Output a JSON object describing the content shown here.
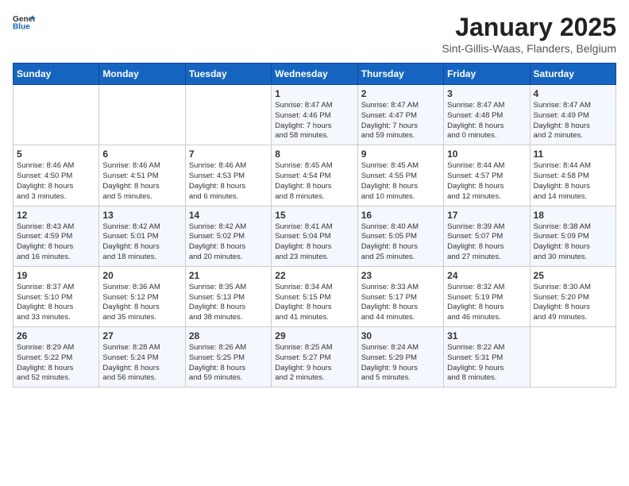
{
  "header": {
    "logo_general": "General",
    "logo_blue": "Blue",
    "month_title": "January 2025",
    "location": "Sint-Gillis-Waas, Flanders, Belgium"
  },
  "weekdays": [
    "Sunday",
    "Monday",
    "Tuesday",
    "Wednesday",
    "Thursday",
    "Friday",
    "Saturday"
  ],
  "weeks": [
    [
      {
        "day": "",
        "text": ""
      },
      {
        "day": "",
        "text": ""
      },
      {
        "day": "",
        "text": ""
      },
      {
        "day": "1",
        "text": "Sunrise: 8:47 AM\nSunset: 4:46 PM\nDaylight: 7 hours\nand 58 minutes."
      },
      {
        "day": "2",
        "text": "Sunrise: 8:47 AM\nSunset: 4:47 PM\nDaylight: 7 hours\nand 59 minutes."
      },
      {
        "day": "3",
        "text": "Sunrise: 8:47 AM\nSunset: 4:48 PM\nDaylight: 8 hours\nand 0 minutes."
      },
      {
        "day": "4",
        "text": "Sunrise: 8:47 AM\nSunset: 4:49 PM\nDaylight: 8 hours\nand 2 minutes."
      }
    ],
    [
      {
        "day": "5",
        "text": "Sunrise: 8:46 AM\nSunset: 4:50 PM\nDaylight: 8 hours\nand 3 minutes."
      },
      {
        "day": "6",
        "text": "Sunrise: 8:46 AM\nSunset: 4:51 PM\nDaylight: 8 hours\nand 5 minutes."
      },
      {
        "day": "7",
        "text": "Sunrise: 8:46 AM\nSunset: 4:53 PM\nDaylight: 8 hours\nand 6 minutes."
      },
      {
        "day": "8",
        "text": "Sunrise: 8:45 AM\nSunset: 4:54 PM\nDaylight: 8 hours\nand 8 minutes."
      },
      {
        "day": "9",
        "text": "Sunrise: 8:45 AM\nSunset: 4:55 PM\nDaylight: 8 hours\nand 10 minutes."
      },
      {
        "day": "10",
        "text": "Sunrise: 8:44 AM\nSunset: 4:57 PM\nDaylight: 8 hours\nand 12 minutes."
      },
      {
        "day": "11",
        "text": "Sunrise: 8:44 AM\nSunset: 4:58 PM\nDaylight: 8 hours\nand 14 minutes."
      }
    ],
    [
      {
        "day": "12",
        "text": "Sunrise: 8:43 AM\nSunset: 4:59 PM\nDaylight: 8 hours\nand 16 minutes."
      },
      {
        "day": "13",
        "text": "Sunrise: 8:42 AM\nSunset: 5:01 PM\nDaylight: 8 hours\nand 18 minutes."
      },
      {
        "day": "14",
        "text": "Sunrise: 8:42 AM\nSunset: 5:02 PM\nDaylight: 8 hours\nand 20 minutes."
      },
      {
        "day": "15",
        "text": "Sunrise: 8:41 AM\nSunset: 5:04 PM\nDaylight: 8 hours\nand 23 minutes."
      },
      {
        "day": "16",
        "text": "Sunrise: 8:40 AM\nSunset: 5:05 PM\nDaylight: 8 hours\nand 25 minutes."
      },
      {
        "day": "17",
        "text": "Sunrise: 8:39 AM\nSunset: 5:07 PM\nDaylight: 8 hours\nand 27 minutes."
      },
      {
        "day": "18",
        "text": "Sunrise: 8:38 AM\nSunset: 5:09 PM\nDaylight: 8 hours\nand 30 minutes."
      }
    ],
    [
      {
        "day": "19",
        "text": "Sunrise: 8:37 AM\nSunset: 5:10 PM\nDaylight: 8 hours\nand 33 minutes."
      },
      {
        "day": "20",
        "text": "Sunrise: 8:36 AM\nSunset: 5:12 PM\nDaylight: 8 hours\nand 35 minutes."
      },
      {
        "day": "21",
        "text": "Sunrise: 8:35 AM\nSunset: 5:13 PM\nDaylight: 8 hours\nand 38 minutes."
      },
      {
        "day": "22",
        "text": "Sunrise: 8:34 AM\nSunset: 5:15 PM\nDaylight: 8 hours\nand 41 minutes."
      },
      {
        "day": "23",
        "text": "Sunrise: 8:33 AM\nSunset: 5:17 PM\nDaylight: 8 hours\nand 44 minutes."
      },
      {
        "day": "24",
        "text": "Sunrise: 8:32 AM\nSunset: 5:19 PM\nDaylight: 8 hours\nand 46 minutes."
      },
      {
        "day": "25",
        "text": "Sunrise: 8:30 AM\nSunset: 5:20 PM\nDaylight: 8 hours\nand 49 minutes."
      }
    ],
    [
      {
        "day": "26",
        "text": "Sunrise: 8:29 AM\nSunset: 5:22 PM\nDaylight: 8 hours\nand 52 minutes."
      },
      {
        "day": "27",
        "text": "Sunrise: 8:28 AM\nSunset: 5:24 PM\nDaylight: 8 hours\nand 56 minutes."
      },
      {
        "day": "28",
        "text": "Sunrise: 8:26 AM\nSunset: 5:25 PM\nDaylight: 8 hours\nand 59 minutes."
      },
      {
        "day": "29",
        "text": "Sunrise: 8:25 AM\nSunset: 5:27 PM\nDaylight: 9 hours\nand 2 minutes."
      },
      {
        "day": "30",
        "text": "Sunrise: 8:24 AM\nSunset: 5:29 PM\nDaylight: 9 hours\nand 5 minutes."
      },
      {
        "day": "31",
        "text": "Sunrise: 8:22 AM\nSunset: 5:31 PM\nDaylight: 9 hours\nand 8 minutes."
      },
      {
        "day": "",
        "text": ""
      }
    ]
  ]
}
